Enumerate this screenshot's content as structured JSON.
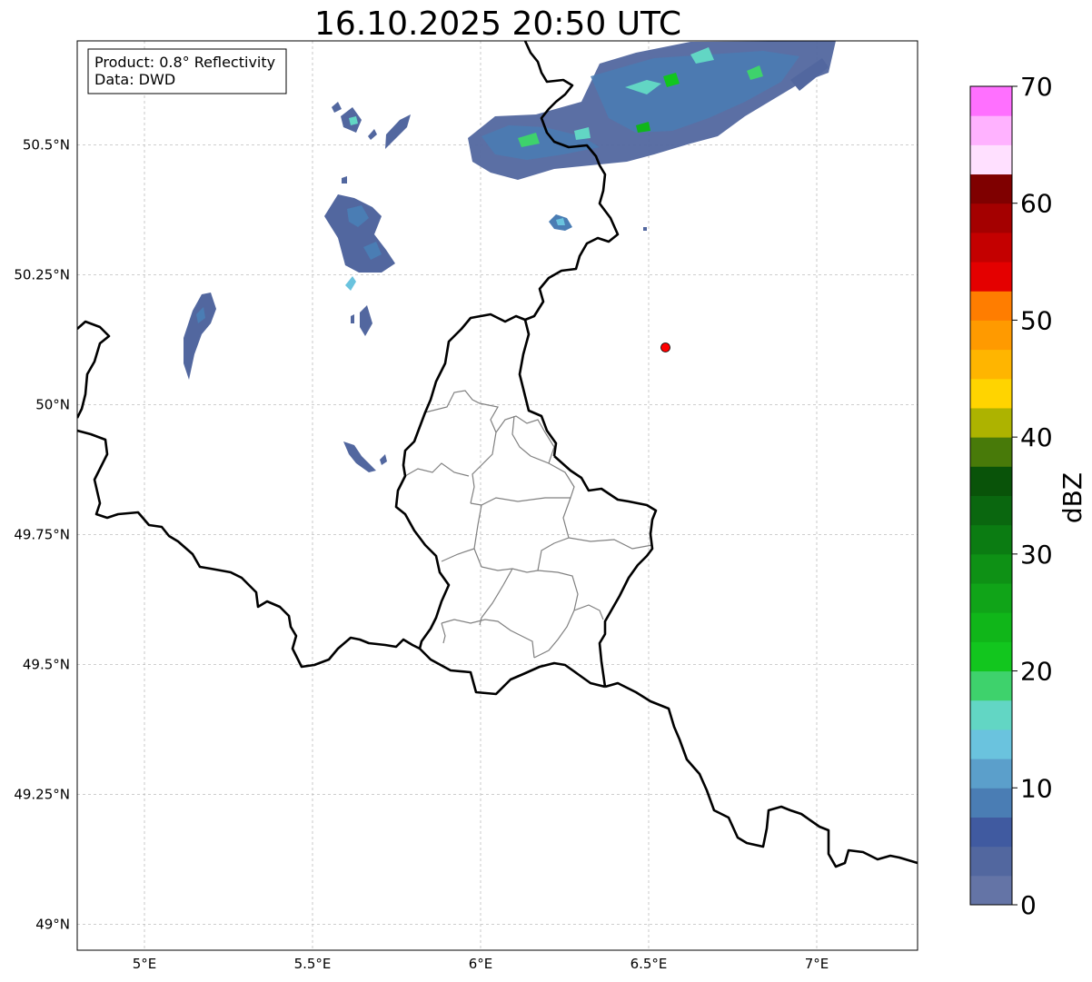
{
  "title": "16.10.2025 20:50 UTC",
  "info_box": {
    "product_line": "Product: 0.8° Reflectivity",
    "source_line": "Data: DWD"
  },
  "map": {
    "lon_range": [
      4.8,
      7.3
    ],
    "lat_range": [
      48.95,
      50.7
    ],
    "lon_ticks": [
      {
        "value": 5.0,
        "label": "5°E"
      },
      {
        "value": 5.5,
        "label": "5.5°E"
      },
      {
        "value": 6.0,
        "label": "6°E"
      },
      {
        "value": 6.5,
        "label": "6.5°E"
      },
      {
        "value": 7.0,
        "label": "7°E"
      }
    ],
    "lat_ticks": [
      {
        "value": 50.5,
        "label": "50.5°N"
      },
      {
        "value": 50.25,
        "label": "50.25°N"
      },
      {
        "value": 50.0,
        "label": "50°N"
      },
      {
        "value": 49.75,
        "label": "49.75°N"
      },
      {
        "value": 49.5,
        "label": "49.5°N"
      },
      {
        "value": 49.25,
        "label": "49.25°N"
      },
      {
        "value": 49.0,
        "label": "49°N"
      }
    ],
    "gridlines": true,
    "marker": {
      "lon": 6.55,
      "lat": 50.11,
      "color": "#ff0000"
    }
  },
  "colorbar": {
    "label": "dBZ",
    "min": 0,
    "max": 70,
    "step": 2.5,
    "tick_values": [
      0,
      10,
      20,
      30,
      40,
      50,
      60,
      70
    ],
    "tick_labels": [
      "0",
      "10",
      "20",
      "30",
      "40",
      "50",
      "60",
      "70"
    ],
    "colors": [
      "#6474a6",
      "#52679f",
      "#405aa0",
      "#4a7db4",
      "#5b9fcb",
      "#6ac3de",
      "#62d6c4",
      "#3ed26c",
      "#12c61e",
      "#10b619",
      "#10a418",
      "#0e9115",
      "#0b7c12",
      "#0a670f",
      "#095309",
      "#487a09",
      "#adb300",
      "#ffd400",
      "#ffb500",
      "#ff9a00",
      "#ff7d00",
      "#e40000",
      "#c40000",
      "#a40000",
      "#7f0000",
      "#ffe0ff",
      "#ffb2ff",
      "#ff70ff",
      "#ea30ea"
    ]
  }
}
